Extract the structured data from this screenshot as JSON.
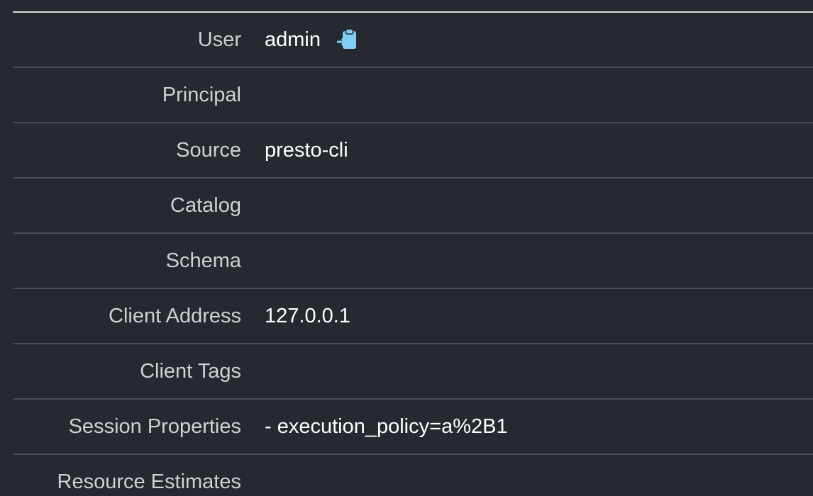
{
  "session": {
    "rows": [
      {
        "label": "User",
        "value": "admin"
      },
      {
        "label": "Principal",
        "value": ""
      },
      {
        "label": "Source",
        "value": "presto-cli"
      },
      {
        "label": "Catalog",
        "value": ""
      },
      {
        "label": "Schema",
        "value": ""
      },
      {
        "label": "Client Address",
        "value": "127.0.0.1"
      },
      {
        "label": "Client Tags",
        "value": ""
      },
      {
        "label": "Session Properties",
        "value": "- execution_policy=a%2B1"
      },
      {
        "label": "Resource Estimates",
        "value": ""
      }
    ],
    "copy_icon": "clipboard-copy-icon",
    "accent_color": "#7fcff4"
  }
}
